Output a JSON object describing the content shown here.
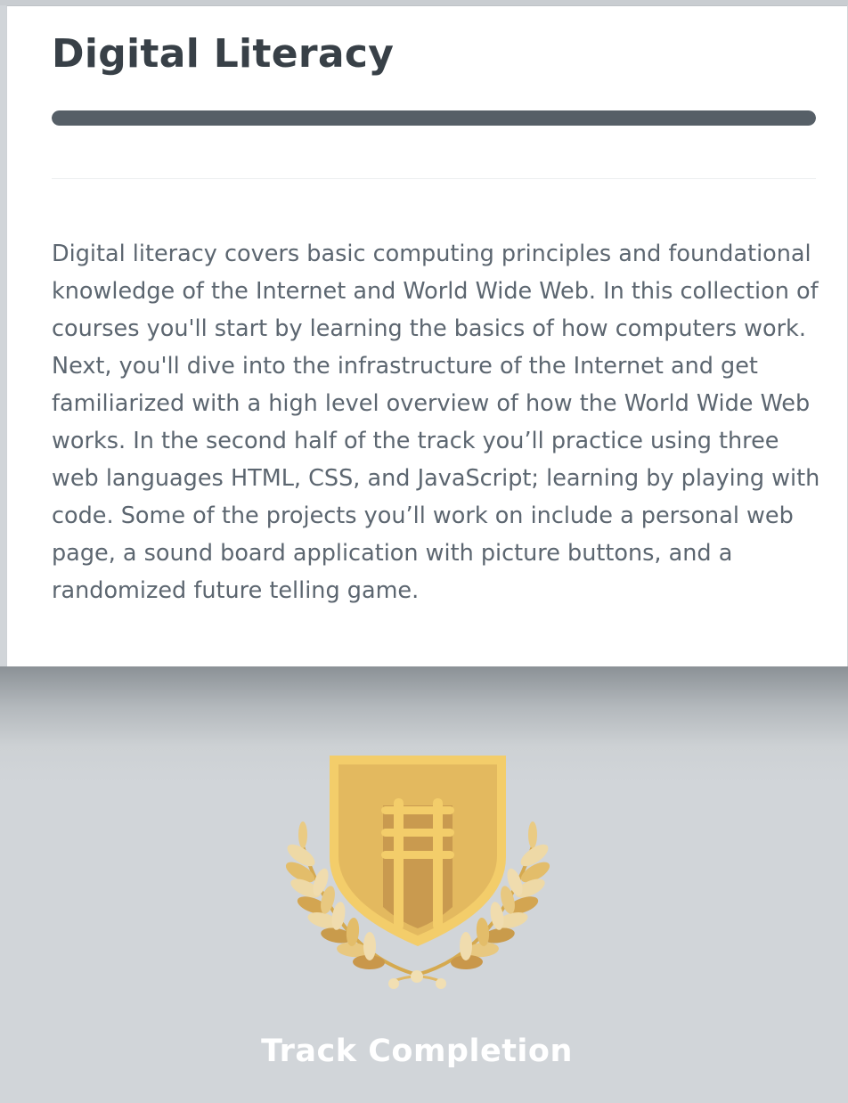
{
  "track": {
    "title": "Digital Literacy",
    "progress_percent": 100,
    "description": "Digital literacy covers basic computing principles and foundational knowledge of the Internet and World Wide Web. In this collection of courses you'll start by learning the basics of how computers work. Next, you'll dive into the infrastructure of the Internet and get familiarized with a high level overview of how the World Wide Web works. In the second half of the track you’ll practice using three web languages HTML, CSS, and JavaScript; learning by playing with code. Some of the projects you’ll work on include a personal web page, a sound board application with picture buttons, and a randomized future telling game."
  },
  "completion": {
    "label": "Track Completion",
    "badge_icon": "laurel-shield-badge-icon"
  },
  "colors": {
    "progress_fill": "#565f67",
    "title_text": "#384047",
    "body_text": "#5c6670",
    "badge_gold": "#e3b95f",
    "lower_background": "#d1d5d9"
  }
}
